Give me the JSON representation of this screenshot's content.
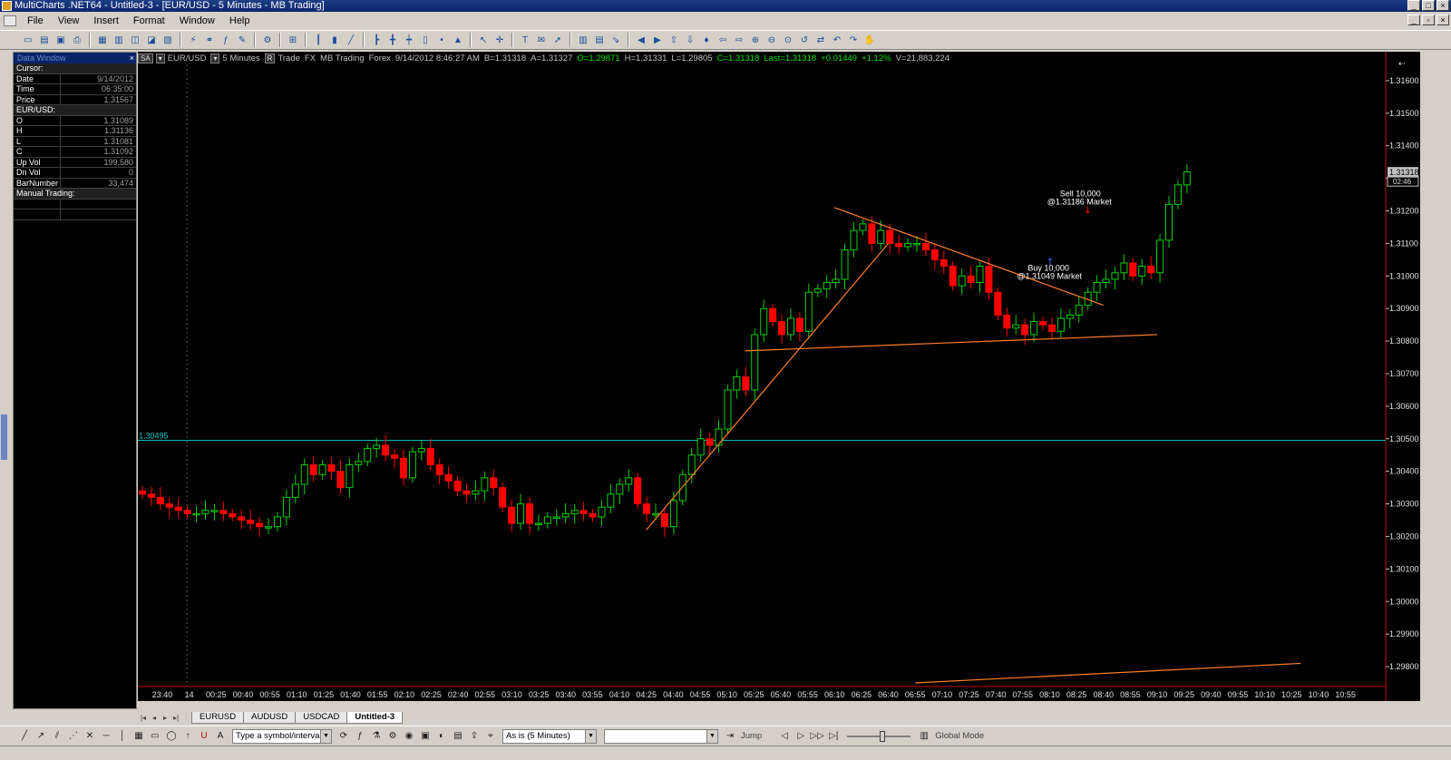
{
  "window": {
    "title": "MultiCharts .NET64 - Untitled-3 - [EUR/USD - 5 Minutes - MB Trading]"
  },
  "menu": {
    "items": [
      "File",
      "View",
      "Insert",
      "Format",
      "Window",
      "Help"
    ]
  },
  "data_window": {
    "title": "Data Window",
    "cursor_label": "Cursor:",
    "cursor_rows": [
      {
        "k": "Date",
        "v": "9/14/2012"
      },
      {
        "k": "Time",
        "v": "06:35:00"
      },
      {
        "k": "Price",
        "v": "1.31567"
      }
    ],
    "symbol_label": "EUR/USD:",
    "symbol_rows": [
      {
        "k": "O",
        "v": "1.31089"
      },
      {
        "k": "H",
        "v": "1.31136"
      },
      {
        "k": "L",
        "v": "1.31081"
      },
      {
        "k": "C",
        "v": "1.31092"
      },
      {
        "k": "Up Vol",
        "v": "199,580"
      },
      {
        "k": "Dn Vol",
        "v": "0"
      },
      {
        "k": "BarNumber",
        "v": "33,474"
      }
    ],
    "manual_label": "Manual Trading:"
  },
  "chart_status": {
    "sa": "SA",
    "r": "R",
    "symbol": "EUR/USD",
    "interval": "5 Minutes",
    "mode": "Trade",
    "category": "FX",
    "feed": "MB Trading",
    "exchange": "Forex",
    "datetime": "9/14/2012 8:46:27 AM",
    "bid": "B=1.31318",
    "ask": "A=1.31327",
    "open": "O=1.29871",
    "high": "H=1.31331",
    "low": "L=1.29805",
    "close": "C=1.31318",
    "last": "Last=1.31318",
    "change": "+0.01449",
    "change_pct": "+1.12%",
    "volume": "V=21,883,224"
  },
  "chart_data": {
    "type": "candlestick",
    "price_axis": {
      "ticks": [
        "1.31600",
        "1.31500",
        "1.31400",
        "1.31300",
        "1.31200",
        "1.31100",
        "1.31000",
        "1.30900",
        "1.30800",
        "1.30700",
        "1.30600",
        "1.30500",
        "1.30400",
        "1.30300",
        "1.30200",
        "1.30100",
        "1.30000",
        "1.29900",
        "1.29800"
      ],
      "range": [
        1.2975,
        1.3165
      ]
    },
    "time_axis": {
      "ticks": [
        "23:40",
        "14",
        "00:25",
        "00:40",
        "00:55",
        "01:10",
        "01:25",
        "01:40",
        "01:55",
        "02:10",
        "02:25",
        "02:40",
        "02:55",
        "03:10",
        "03:25",
        "03:40",
        "03:55",
        "04:10",
        "04:25",
        "04:40",
        "04:55",
        "05:10",
        "05:25",
        "05:40",
        "05:55",
        "06:10",
        "06:25",
        "06:40",
        "06:55",
        "07:10",
        "07:25",
        "07:40",
        "07:55",
        "08:10",
        "08:25",
        "08:40",
        "08:55",
        "09:10",
        "09:25",
        "09:40",
        "09:55",
        "10:10",
        "10:25",
        "10:40",
        "10:55"
      ]
    },
    "horizontal_line": {
      "value": 1.30495,
      "label": "1.30495"
    },
    "last_price_label": "1.31318",
    "countdown_label": "02:46",
    "candles_close": [
      1.3033,
      1.3032,
      1.303,
      1.3029,
      1.3028,
      1.3027,
      1.3027,
      1.3028,
      1.3028,
      1.3027,
      1.3026,
      1.3025,
      1.3024,
      1.3023,
      1.3023,
      1.3026,
      1.3032,
      1.3036,
      1.3042,
      1.3039,
      1.3042,
      1.304,
      1.3035,
      1.3042,
      1.3043,
      1.3047,
      1.3048,
      1.3045,
      1.3044,
      1.3038,
      1.3046,
      1.3047,
      1.3042,
      1.3039,
      1.3037,
      1.3034,
      1.3033,
      1.3034,
      1.3038,
      1.3035,
      1.3029,
      1.3024,
      1.303,
      1.3024,
      1.3024,
      1.3026,
      1.3026,
      1.3027,
      1.3028,
      1.3027,
      1.3026,
      1.3029,
      1.3033,
      1.3036,
      1.3038,
      1.303,
      1.3027,
      1.3027,
      1.3023,
      1.3031,
      1.3039,
      1.3045,
      1.305,
      1.3048,
      1.3053,
      1.3065,
      1.3069,
      1.3065,
      1.3082,
      1.309,
      1.3086,
      1.3082,
      1.3087,
      1.3083,
      1.3095,
      1.3096,
      1.3098,
      1.3099,
      1.3108,
      1.3114,
      1.3116,
      1.311,
      1.3114,
      1.311,
      1.3109,
      1.311,
      1.311,
      1.3108,
      1.3105,
      1.3103,
      1.3097,
      1.31,
      1.3098,
      1.3103,
      1.3095,
      1.3088,
      1.3084,
      1.3085,
      1.3082,
      1.3086,
      1.3085,
      1.3083,
      1.3087,
      1.3088,
      1.3091,
      1.3095,
      1.3098,
      1.3099,
      1.3101,
      1.3104,
      1.31,
      1.3103,
      1.3101,
      1.3111,
      1.3122,
      1.3128,
      1.3132
    ],
    "trendlines": [
      {
        "from": [
          "04:25",
          1.3022
        ],
        "to": [
          "06:40",
          1.311
        ]
      },
      {
        "from": [
          "06:10",
          1.3121
        ],
        "to": [
          "08:40",
          1.3091
        ]
      },
      {
        "from": [
          "05:20",
          1.3077
        ],
        "to": [
          "09:10",
          1.3082
        ]
      },
      {
        "from": [
          "06:55",
          1.2975
        ],
        "to": [
          "10:30",
          1.2981
        ]
      }
    ],
    "trades": [
      {
        "side": "Sell",
        "label": "Sell 10,000",
        "sublabel": "@1.31186 Market",
        "time": "08:40",
        "price": 1.31186
      },
      {
        "side": "Buy",
        "label": "Buy 10,000",
        "sublabel": "@1.31049 Market",
        "time": "08:15",
        "price": 1.31049
      }
    ]
  },
  "sheet_tabs": [
    "EURUSD",
    "AUDUSD",
    "USDCAD",
    "Untitled-3"
  ],
  "drawbar": {
    "symbol_combo": "Type a symbol/interval",
    "interval_combo": "As is (5 Minutes)",
    "jump_label": "Jump",
    "global_mode_label": "Global Mode"
  },
  "colors": {
    "up": "#00d000",
    "down": "#ff0000",
    "trendline": "#ff7f2a",
    "hline": "#00c8c8"
  }
}
